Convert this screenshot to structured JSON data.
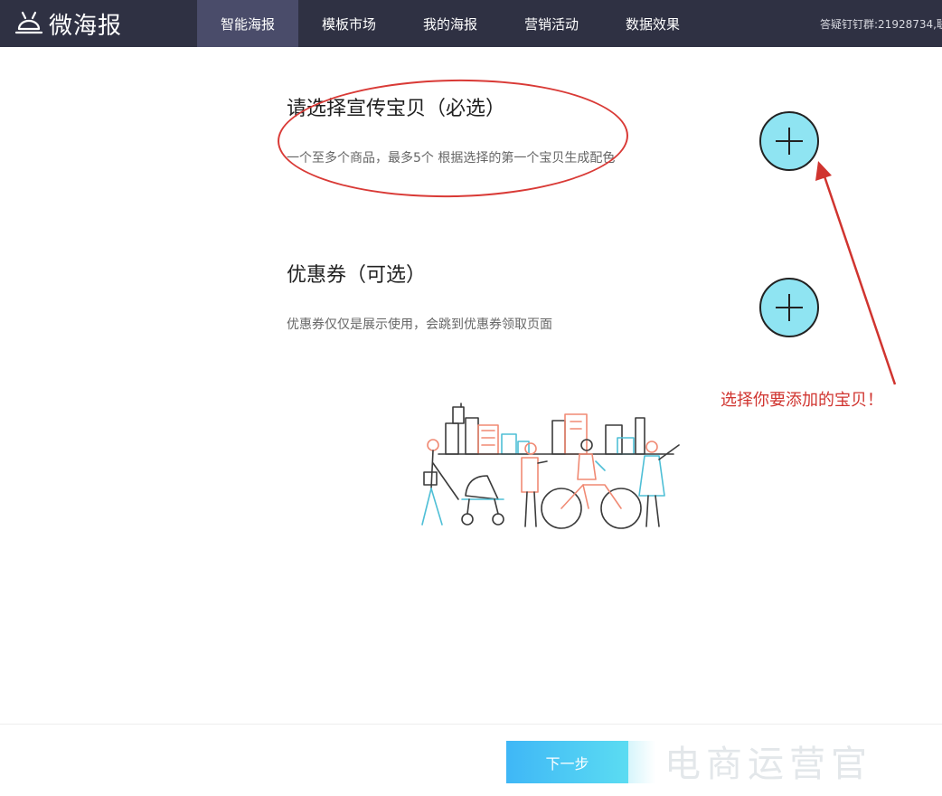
{
  "brand": {
    "name": "微海报"
  },
  "nav": {
    "items": [
      {
        "label": "智能海报"
      },
      {
        "label": "模板市场"
      },
      {
        "label": "我的海报"
      },
      {
        "label": "营销活动"
      },
      {
        "label": "数据效果"
      }
    ],
    "active_index": 0,
    "support_text": "答疑钉钉群:21928734,联"
  },
  "sections": {
    "product": {
      "title": "请选择宣传宝贝（必选）",
      "description": "一个至多个商品，最多5个 根据选择的第一个宝贝生成配色"
    },
    "coupon": {
      "title": "优惠券（可选）",
      "description": "优惠券仅仅是展示使用，会跳到优惠券领取页面"
    }
  },
  "annotation": {
    "text": "选择你要添加的宝贝！",
    "color": "#d0342f"
  },
  "footer": {
    "next_label": "下一步"
  },
  "watermark": {
    "text": "电商运营官"
  },
  "colors": {
    "topbar": "#2f3143",
    "nav_active": "#4a4c6a",
    "add_button": "#8fe4f2",
    "accent_gradient_start": "#3fb7f6",
    "accent_gradient_end": "#5bdcf2"
  }
}
